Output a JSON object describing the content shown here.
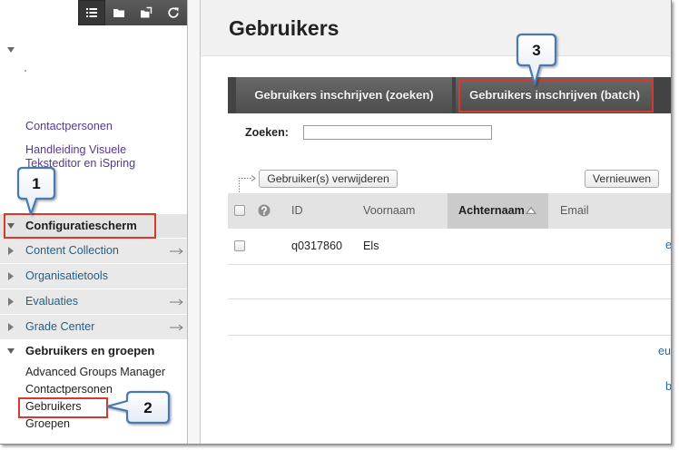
{
  "toolbar": {
    "icons": [
      "list-icon",
      "folder-icon",
      "folder-tree-icon",
      "refresh-icon"
    ]
  },
  "sidebar": {
    "links": [
      {
        "label": "Contactpersonen"
      },
      {
        "label": "Handleiding Visuele Teksteditor en iSpring"
      }
    ],
    "control_panel": {
      "title": "Configuratiescherm",
      "items": [
        {
          "label": "Content Collection",
          "has_arrow": true
        },
        {
          "label": "Organisatietools",
          "has_arrow": false
        },
        {
          "label": "Evaluaties",
          "has_arrow": true
        },
        {
          "label": "Grade Center",
          "has_arrow": true
        }
      ]
    },
    "users_groups": {
      "title": "Gebruikers en groepen",
      "items": [
        {
          "label": "Advanced Groups Manager"
        },
        {
          "label": "Contactpersonen"
        },
        {
          "label": "Gebruikers"
        },
        {
          "label": "Groepen"
        }
      ]
    }
  },
  "page": {
    "title": "Gebruikers"
  },
  "tabs": [
    {
      "label": "Gebruikers inschrijven (zoeken)"
    },
    {
      "label": "Gebruikers inschrijven (batch)"
    }
  ],
  "search": {
    "label": "Zoeken:",
    "value": ""
  },
  "actions": {
    "delete_label": "Gebruiker(s) verwijderen",
    "refresh_label": "Vernieuwen"
  },
  "table": {
    "columns": [
      {
        "label": "ID"
      },
      {
        "label": "Voornaam"
      },
      {
        "label": "Achternaam",
        "sorted": true
      },
      {
        "label": "Email"
      }
    ],
    "rows": [
      {
        "id": "q0317860",
        "first_name": "Els",
        "last_name": "",
        "email": ""
      }
    ]
  },
  "clipped_text": [
    "e",
    "euv",
    "b"
  ],
  "callouts": [
    "1",
    "2",
    "3"
  ],
  "colors": {
    "accent_red": "#d8392f",
    "callout_border": "#4a78b3",
    "link_purple": "#563a8a",
    "link_teal": "#22618c",
    "toolbar_bg": "#474747",
    "tab_bar_bg": "#434343",
    "fragment_blue": "#2b6aa3"
  }
}
